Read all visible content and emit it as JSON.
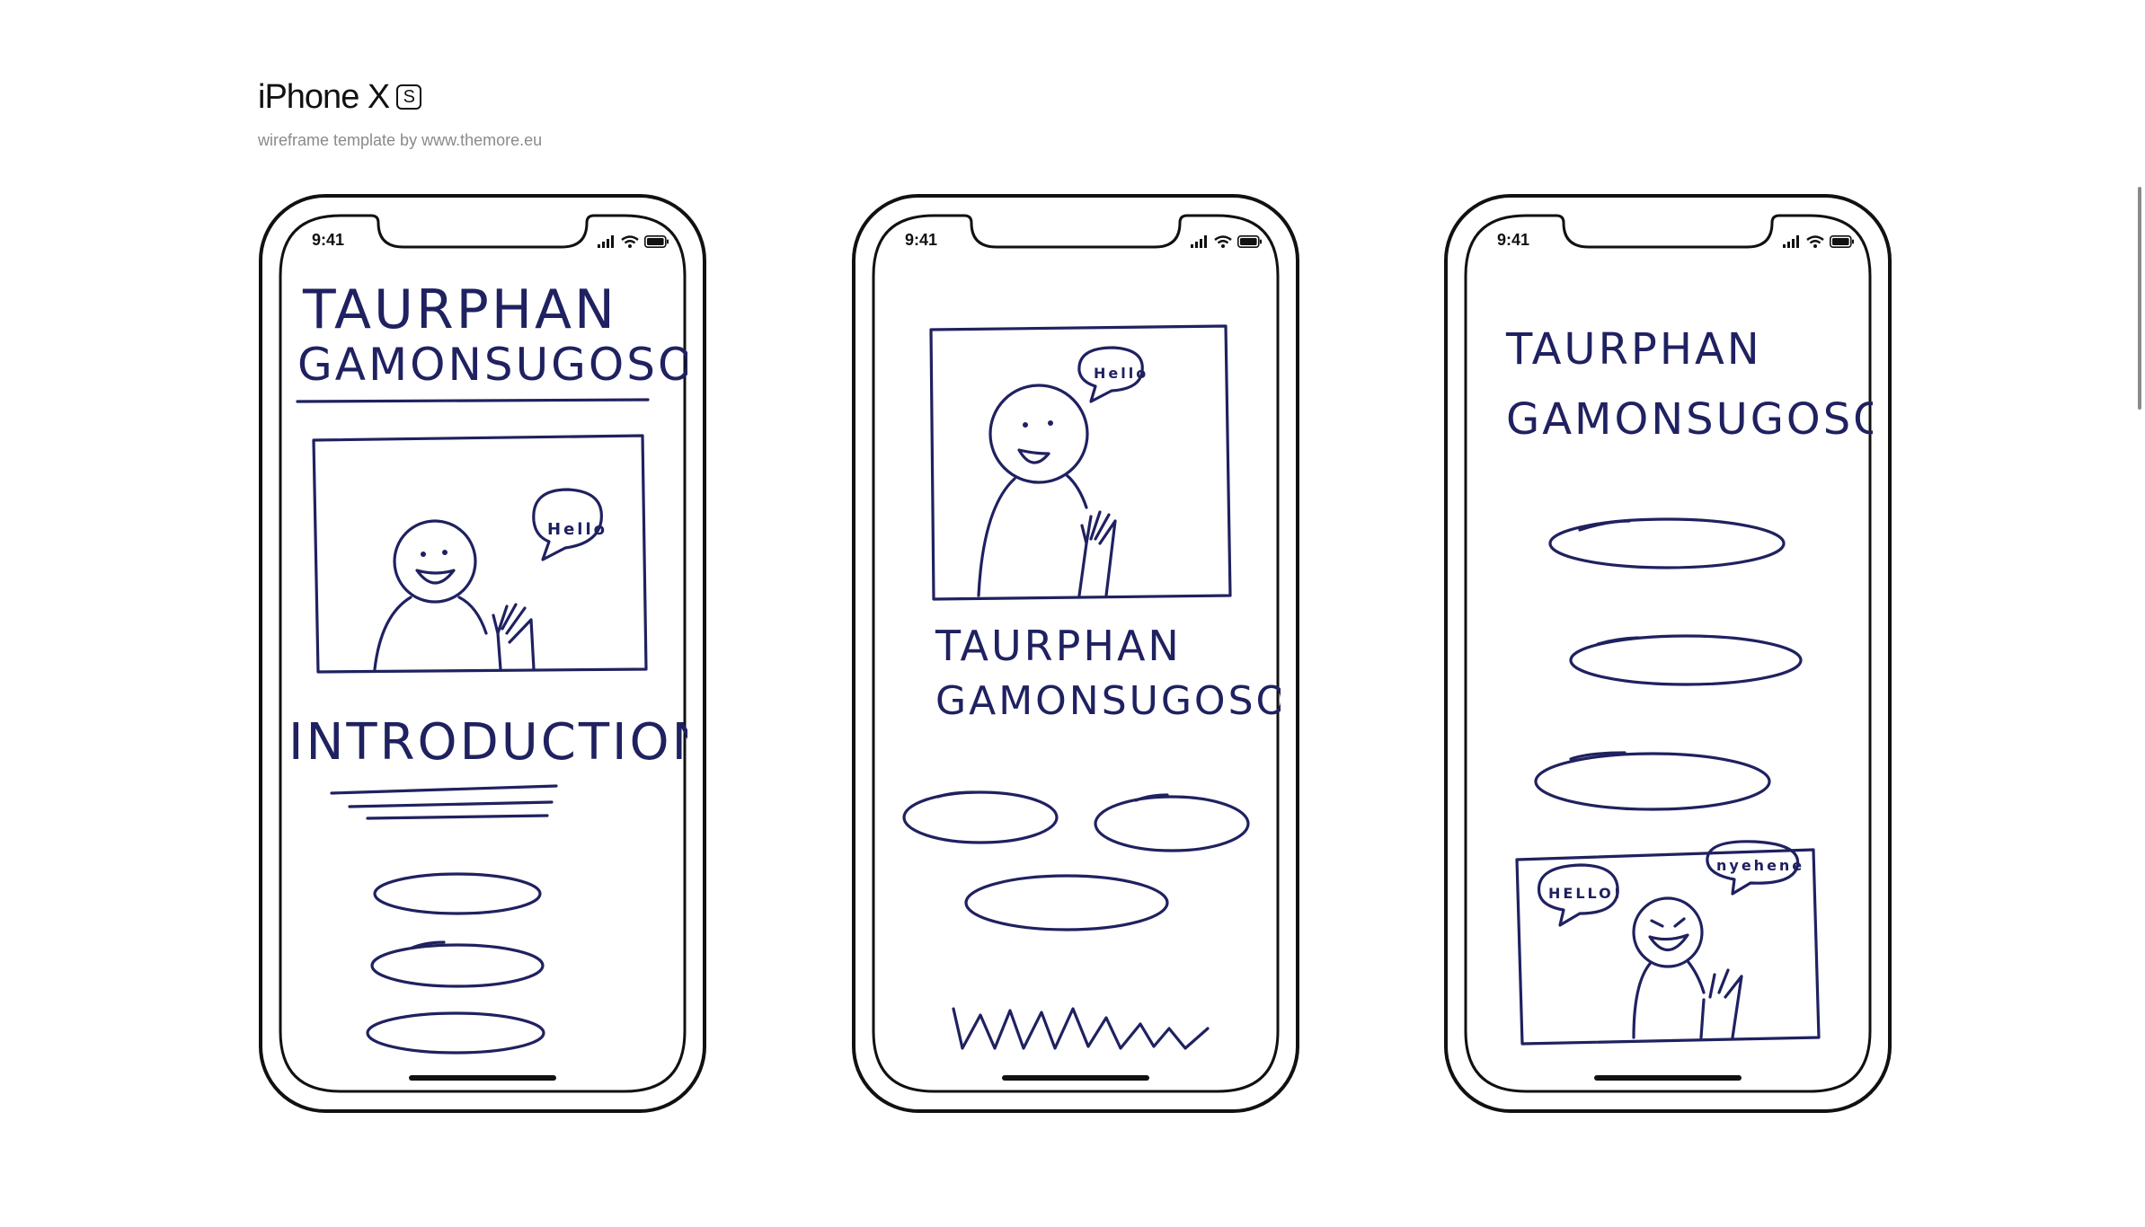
{
  "header": {
    "brand_text": "iPhone X",
    "brand_badge": "S",
    "subtitle": "wireframe template by www.themore.eu"
  },
  "phones": [
    {
      "time": "9:41",
      "title_line1": "TAURPHAN",
      "title_line2": "GAMONSUGOSOL",
      "bubble": "Hello",
      "section": "INTRODUCTION"
    },
    {
      "time": "9:41",
      "title_line1": "TAURPHAN",
      "title_line2": "GAMONSUGOSOL",
      "bubble": "Hello"
    },
    {
      "time": "9:41",
      "title_line1": "TAURPHAN",
      "title_line2": "GAMONSUGOSOL",
      "bubble_left": "HELLO!",
      "bubble_right": "nyehene"
    }
  ],
  "icons": {
    "signal": "cellular-signal-icon",
    "wifi": "wifi-icon",
    "battery": "battery-icon"
  },
  "colors": {
    "ink": "#1f2160",
    "frame": "#111111",
    "subtitle": "#8a8a8a"
  }
}
